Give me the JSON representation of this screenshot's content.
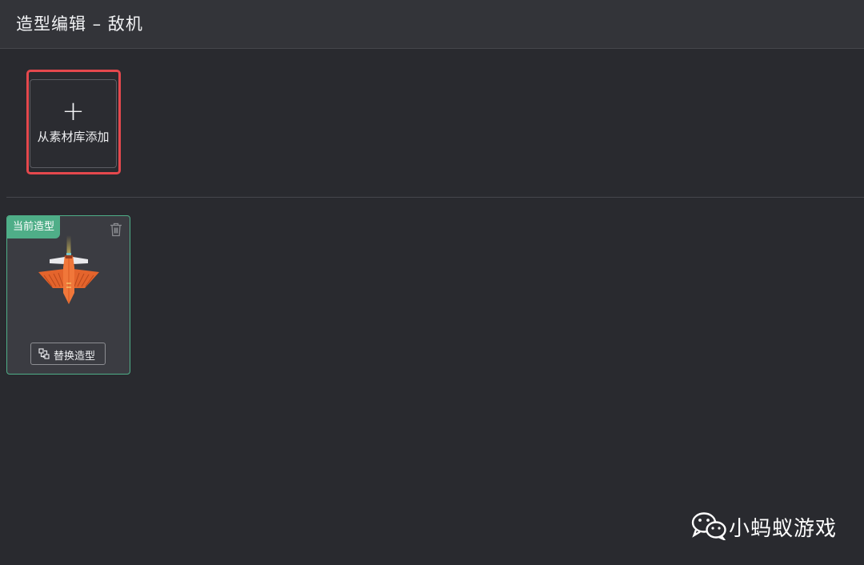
{
  "header": {
    "title": "造型编辑 – 敌机"
  },
  "add_tile": {
    "icon": "plus-icon",
    "label": "从素材库添加"
  },
  "costume": {
    "badge": "当前造型",
    "sprite": "enemy-plane-sprite",
    "replace_label": "替换造型"
  },
  "watermark": {
    "text": "小蚂蚁游戏"
  },
  "colors": {
    "background": "#292a2f",
    "header": "#333439",
    "highlight": "#e5484d",
    "accent_green": "#4fae88",
    "plane_orange": "#f0773a"
  }
}
